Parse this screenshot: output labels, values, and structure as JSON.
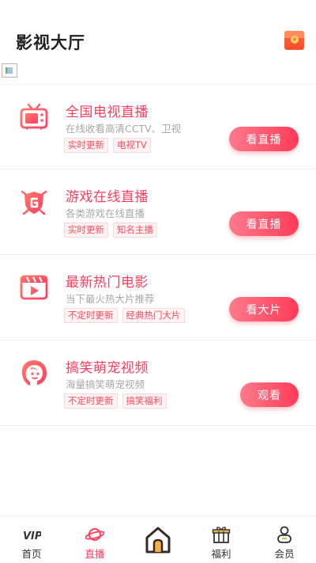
{
  "header": {
    "title": "影视大厅",
    "redpacket_symbol": "¥"
  },
  "colors": {
    "accent": "#ff3d5c",
    "accent_light": "#ff7a8c",
    "subtitle": "#a8a8a8",
    "tag_bg": "#fff3f4"
  },
  "cards": [
    {
      "icon": "tv-icon",
      "title": "全国电视直播",
      "subtitle": "在线收看高清CCTV、卫视",
      "tags": [
        "实时更新",
        "电视TV"
      ],
      "button": "看直播"
    },
    {
      "icon": "game-shield-icon",
      "title": "游戏在线直播",
      "subtitle": "各类游戏在线直播",
      "tags": [
        "实时更新",
        "知名主播"
      ],
      "button": "看直播"
    },
    {
      "icon": "film-clapper-icon",
      "title": "最新热门电影",
      "subtitle": "当下最火热大片推荐",
      "tags": [
        "不定时更新",
        "经典热门大片"
      ],
      "button": "看大片"
    },
    {
      "icon": "woman-face-icon",
      "title": "搞笑萌宠视频",
      "subtitle": "海量搞笑萌宠视频",
      "tags": [
        "不定时更新",
        "搞笑福利"
      ],
      "button": "观看"
    }
  ],
  "tabbar": {
    "tabs": [
      {
        "label": "首页",
        "icon": "vip-icon",
        "active": false
      },
      {
        "label": "直播",
        "icon": "planet-icon",
        "active": true
      },
      {
        "label": "福利",
        "icon": "gift-icon",
        "active": false
      },
      {
        "label": "会员",
        "icon": "user-icon",
        "active": false
      }
    ],
    "center_icon": "home-icon"
  }
}
